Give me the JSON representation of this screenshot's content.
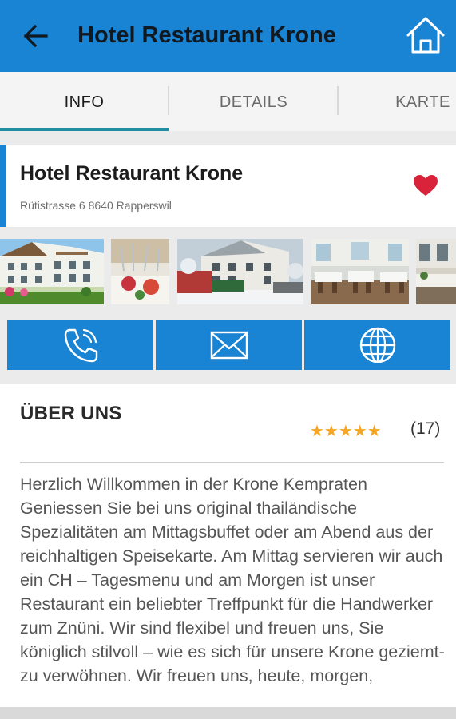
{
  "header": {
    "title": "Hotel Restaurant Krone",
    "color": "#1a84d4",
    "back_icon": "arrow-left-icon",
    "home_icon": "home-icon"
  },
  "tabs": [
    {
      "label": "INFO",
      "active": true
    },
    {
      "label": "DETAILS",
      "active": false
    },
    {
      "label": "KARTE",
      "active": false
    }
  ],
  "listing": {
    "name": "Hotel Restaurant Krone",
    "address": "Rütistrasse 6 8640 Rapperswil",
    "favorite": true,
    "favorite_color": "#d8233a"
  },
  "photos": [
    "hotel-exterior-summer",
    "dining-table-setting",
    "hotel-exterior-winter",
    "restaurant-interior",
    "dining-room"
  ],
  "actions": [
    {
      "icon": "phone-icon"
    },
    {
      "icon": "mail-icon"
    },
    {
      "icon": "globe-icon"
    }
  ],
  "about": {
    "heading": "ÜBER UNS",
    "stars": "★★★★★",
    "rating": 5,
    "review_count": "(17)",
    "text": "Herzlich Willkommen in der Krone Kempraten Geniessen Sie bei uns original thailändische Spezialitäten am Mittagsbuffet oder am Abend aus der reichhaltigen Speisekarte. Am Mittag servieren wir auch ein CH – Tagesmenu und am Morgen ist unser Restaurant ein beliebter Treffpunkt für die Handwerker zum Znüni. Wir sind flexibel und freuen uns, Sie königlich stilvoll – wie es sich für unsere Krone geziemt- zu verwöhnen. Wir freuen uns, heute, morgen,"
  }
}
